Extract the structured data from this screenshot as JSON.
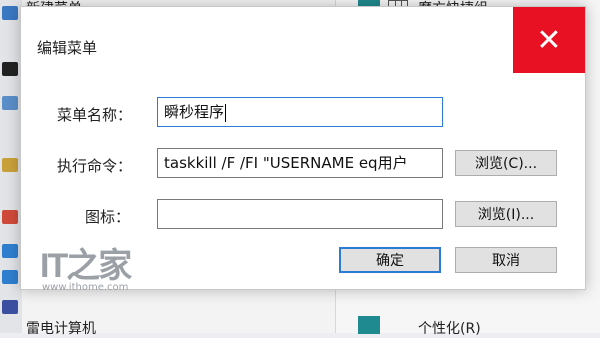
{
  "background": {
    "top_left_item": "新建菜单",
    "bottom_left_item": "雷电计算机",
    "top_right_item": "魔方快捷组",
    "bottom_right_item": "个性化(R)"
  },
  "dialog": {
    "title": "编辑菜单",
    "close_glyph": "✕",
    "name_label": "菜单名称：",
    "name_value": "瞬秒程序",
    "command_label": "执行命令：",
    "command_value": "taskkill /F /FI \"USERNAME eq用户",
    "browse_command_label": "浏览(C)...",
    "icon_label": "图标：",
    "icon_value": "",
    "browse_icon_label": "浏览(I)...",
    "ok_label": "确定",
    "cancel_label": "取消"
  },
  "watermark": {
    "logo": "IT之家",
    "url": "www.ithome.com"
  },
  "colors": {
    "close_button": "#e81123",
    "focus_border": "#2b7bd6",
    "tile_teal": "#1f8a8f"
  }
}
